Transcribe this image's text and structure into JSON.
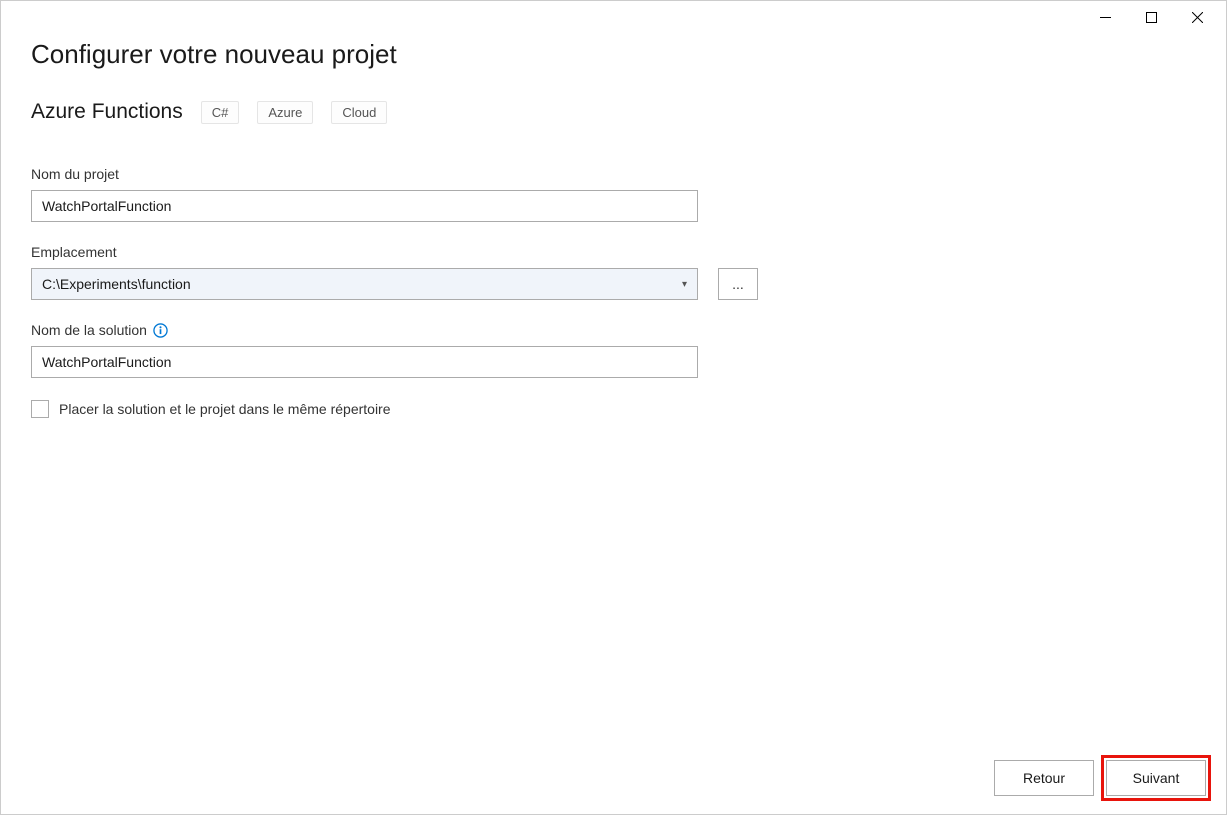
{
  "window": {
    "title": "Configurer votre nouveau projet"
  },
  "subtitle": "Azure Functions",
  "tags": [
    "C#",
    "Azure",
    "Cloud"
  ],
  "form": {
    "project_name": {
      "label": "Nom du projet",
      "value": "WatchPortalFunction"
    },
    "location": {
      "label": "Emplacement",
      "value": "C:\\Experiments\\function",
      "browse_label": "..."
    },
    "solution_name": {
      "label": "Nom de la solution",
      "value": "WatchPortalFunction"
    },
    "same_directory": {
      "label": "Placer la solution et le projet dans le même répertoire",
      "checked": false
    }
  },
  "footer": {
    "back_label": "Retour",
    "next_label": "Suivant"
  }
}
